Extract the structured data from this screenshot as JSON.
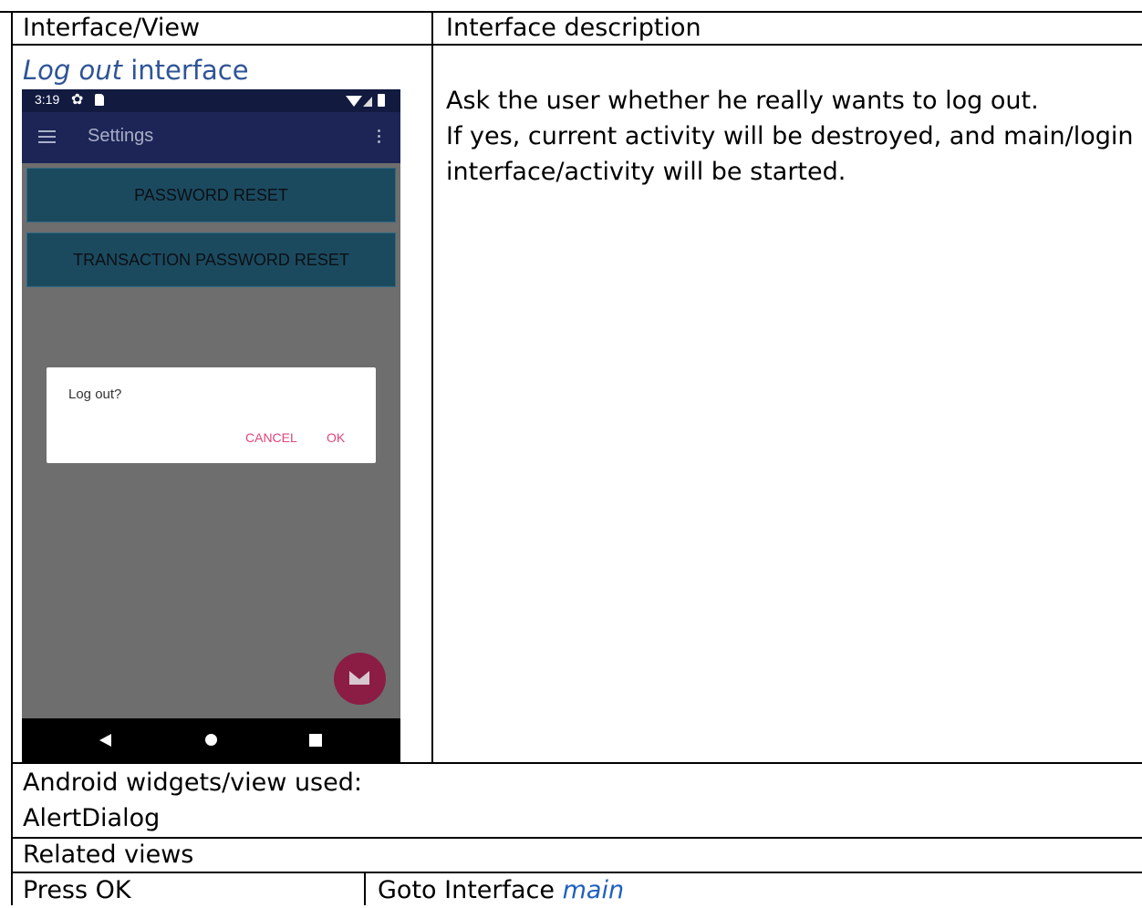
{
  "table": {
    "header": {
      "col1": "Interface/View",
      "col2": "Interface description"
    },
    "caption": {
      "italic": "Log out",
      "rest": " interface"
    },
    "description": [
      "Ask the user whether he really wants to log out.",
      "If yes, current activity will be destroyed, and main/login",
      "interface/activity will be started."
    ],
    "widgets": {
      "label": "Android widgets/view used:",
      "value": "AlertDialog"
    },
    "related": {
      "label": "Related views",
      "action": "Press OK",
      "target_prefix": "Goto Interface ",
      "target_link": "main"
    }
  },
  "phone": {
    "status": {
      "time": "3:19",
      "icons": [
        "gear-icon",
        "sd-card-icon",
        "wifi-icon",
        "signal-icon",
        "battery-icon"
      ]
    },
    "toolbar": {
      "title": "Settings",
      "icons": [
        "menu-icon",
        "overflow-menu-icon"
      ]
    },
    "buttons": {
      "password_reset": "PASSWORD RESET",
      "transaction_password_reset": "TRANSACTION PASSWORD RESET"
    },
    "dialog": {
      "message": "Log out?",
      "cancel": "CANCEL",
      "ok": "OK"
    },
    "fab_icon": "mail-icon",
    "navbar_icons": [
      "back-icon",
      "home-icon",
      "recents-icon"
    ],
    "colors": {
      "status_bar": "#121a40",
      "toolbar": "#1c2556",
      "button": "#1b4a5f",
      "overlay": "#6e6e6e",
      "dialog_accent": "#e0457b",
      "fab": "#8b1c44"
    }
  }
}
